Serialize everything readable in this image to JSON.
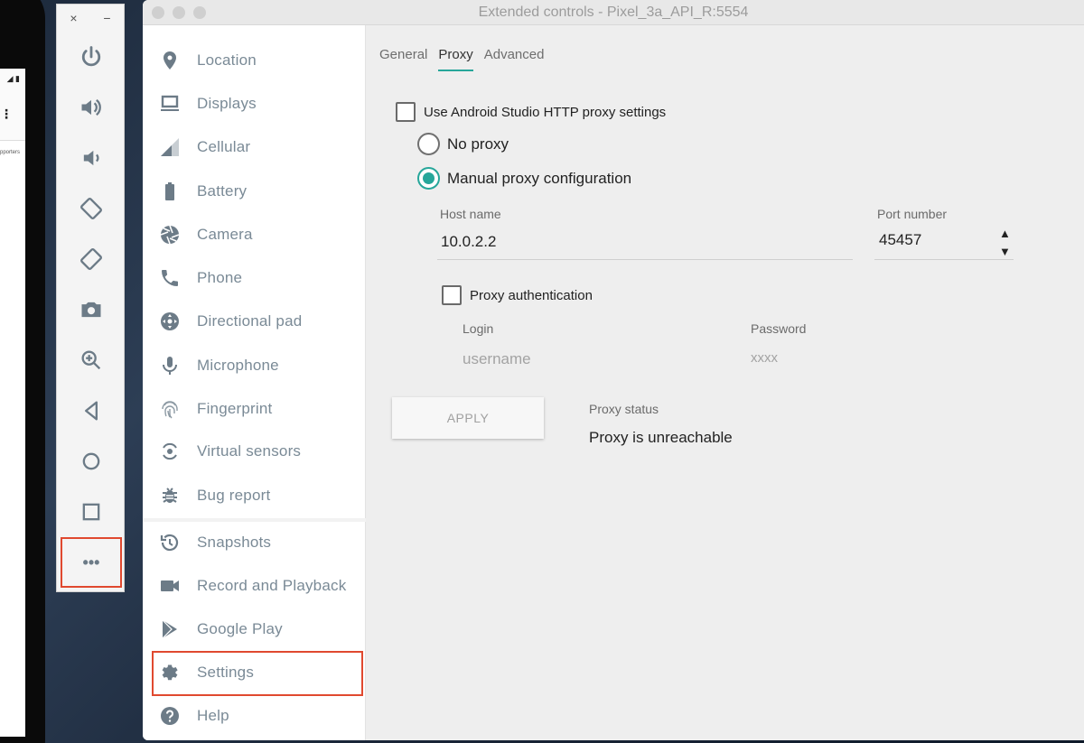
{
  "window": {
    "title": "Extended controls - Pixel_3a_API_R:5554"
  },
  "phone": {
    "tiny_text": "pporters"
  },
  "toolbar": {
    "close": "×",
    "minimize": "−",
    "buttons": [
      {
        "name": "power-icon"
      },
      {
        "name": "volume-up-icon"
      },
      {
        "name": "volume-down-icon"
      },
      {
        "name": "rotate-left-icon"
      },
      {
        "name": "rotate-right-icon"
      },
      {
        "name": "camera-icon"
      },
      {
        "name": "zoom-icon"
      },
      {
        "name": "back-icon"
      },
      {
        "name": "home-icon"
      },
      {
        "name": "overview-icon"
      },
      {
        "name": "more-icon"
      }
    ],
    "more_label": "•••"
  },
  "sidebar": {
    "items": [
      {
        "label": "Location",
        "icon": "location-pin-icon"
      },
      {
        "label": "Displays",
        "icon": "display-icon"
      },
      {
        "label": "Cellular",
        "icon": "cellular-icon"
      },
      {
        "label": "Battery",
        "icon": "battery-icon"
      },
      {
        "label": "Camera",
        "icon": "camera-aperture-icon"
      },
      {
        "label": "Phone",
        "icon": "phone-icon"
      },
      {
        "label": "Directional pad",
        "icon": "dpad-icon"
      },
      {
        "label": "Microphone",
        "icon": "microphone-icon"
      },
      {
        "label": "Fingerprint",
        "icon": "fingerprint-icon"
      },
      {
        "label": "Virtual sensors",
        "icon": "sensors-icon"
      },
      {
        "label": "Bug report",
        "icon": "bug-icon"
      },
      {
        "label": "Snapshots",
        "icon": "history-icon"
      },
      {
        "label": "Record and Playback",
        "icon": "video-camera-icon"
      },
      {
        "label": "Google Play",
        "icon": "play-store-icon"
      },
      {
        "label": "Settings",
        "icon": "gear-icon"
      },
      {
        "label": "Help",
        "icon": "help-icon"
      }
    ]
  },
  "tabs": [
    {
      "label": "General"
    },
    {
      "label": "Proxy",
      "active": true
    },
    {
      "label": "Advanced"
    }
  ],
  "proxy": {
    "use_studio_label": "Use Android Studio HTTP proxy settings",
    "no_proxy_label": "No proxy",
    "manual_label": "Manual proxy configuration",
    "host_label": "Host name",
    "host_value": "10.0.2.2",
    "port_label": "Port number",
    "port_value": "45457",
    "auth_label": "Proxy authentication",
    "login_label": "Login",
    "login_placeholder": "username",
    "password_label": "Password",
    "password_placeholder": "xxxx",
    "apply_label": "APPLY",
    "status_label": "Proxy status",
    "status_value": "Proxy is unreachable"
  },
  "colors": {
    "accent": "#26a69a",
    "highlight": "#e0492f",
    "icon": "#6c7b87"
  }
}
